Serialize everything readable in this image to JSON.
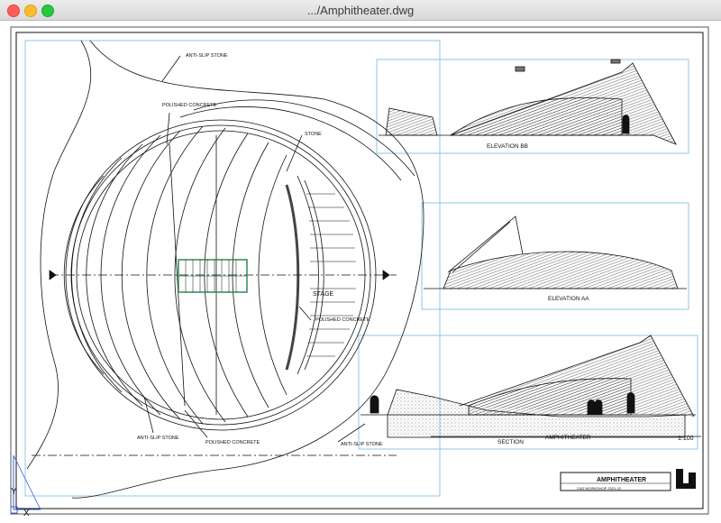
{
  "window": {
    "title": ".../Amphitheater.dwg"
  },
  "drawing": {
    "plan_labels": {
      "anti_slip_stone_top": "ANTI-SLIP STONE",
      "polished_concrete_top": "POLISHED CONCRETE",
      "stone": "STONE",
      "stage": "STAGE",
      "polished_concrete_right": "POLISHED CONCRETE",
      "anti_slip_stone_bottom": "ANTI-SLIP STONE",
      "polished_concrete_bottom": "POLISHED CONCRETE",
      "anti_slip_stone_right": "ANTI-SLIP STONE"
    },
    "elevation_bb": "ELEVATION BB",
    "elevation_aa": "ELEVATION AA",
    "section": "SECTION",
    "amphitheater_small": "AMPHITHEATER",
    "scale": "1:100",
    "title_block": {
      "title": "AMPHITHEATER",
      "subtitle": "CAD WORKSHOP 2021-22"
    },
    "ucs": {
      "y": "Y",
      "x": "X"
    }
  },
  "colors": {
    "viewport_frame": "#8ec7e6",
    "line": "#111111",
    "stair_highlight": "#2e8b57",
    "ucs_icon": "#3a5fd8"
  }
}
